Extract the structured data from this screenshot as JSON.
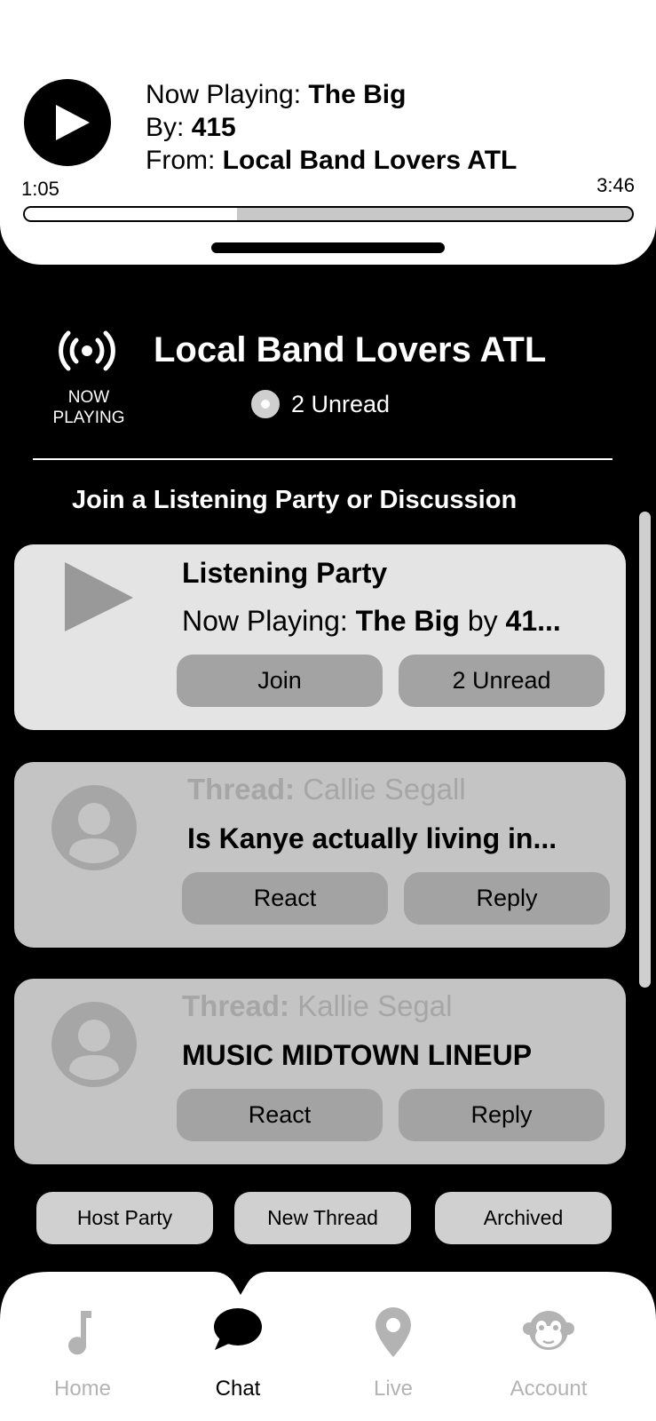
{
  "player": {
    "now_playing_label": "Now Playing: ",
    "track": "The Big",
    "by_label": "By: ",
    "artist": "415",
    "from_label": "From: ",
    "source": "Local Band Lovers ATL",
    "current_time": "1:05",
    "total_time": "3:46",
    "progress_fraction": 0.35
  },
  "channel": {
    "live_caption": "NOW\nPLAYING",
    "title": "Local Band Lovers ATL",
    "unread": "2 Unread"
  },
  "section_title": "Join a Listening Party or Discussion",
  "party_card": {
    "title": "Listening Party",
    "now_playing_label": "Now Playing: ",
    "track": "The Big",
    "by_word": " by ",
    "artist_trunc": "41...",
    "join_label": "Join",
    "unread_label": "2 Unread"
  },
  "threads": [
    {
      "label": "Thread:",
      "author": "Callie Segall",
      "message": "Is Kanye actually living in...",
      "react_label": "React",
      "reply_label": "Reply"
    },
    {
      "label": "Thread:",
      "author": "Kallie Segal",
      "message": "MUSIC MIDTOWN LINEUP",
      "react_label": "React",
      "reply_label": "Reply"
    }
  ],
  "actions": {
    "host_party": "Host Party",
    "new_thread": "New Thread",
    "archived": "Archived"
  },
  "nav": {
    "home": "Home",
    "chat": "Chat",
    "live": "Live",
    "account": "Account",
    "active": "chat"
  },
  "colors": {
    "active_nav": "#000000",
    "inactive_nav": "#b3b3b3"
  }
}
